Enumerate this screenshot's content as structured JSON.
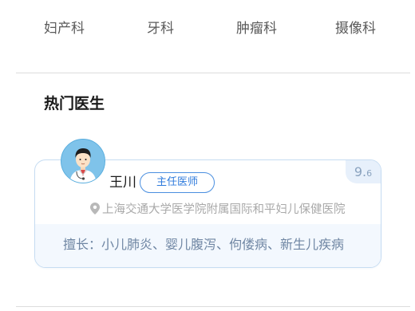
{
  "departments": [
    {
      "label": "妇产科"
    },
    {
      "label": "牙科"
    },
    {
      "label": "肿瘤科"
    },
    {
      "label": "摄像科"
    }
  ],
  "section": {
    "title": "热门医生"
  },
  "doctor": {
    "avatar_icon": "doctor-avatar-icon",
    "name": "王川",
    "title": "主任医师",
    "rating_int": "9.",
    "rating_dec": "6",
    "location_icon": "location-pin-icon",
    "hospital": "上海交通大学医学院附属国际和平妇儿保健医院",
    "specialty": "擅长：小儿肺炎、婴儿腹泻、佝偻病、新生儿疾病"
  },
  "colors": {
    "accent": "#2f7bdc",
    "card_border": "#c6dcf2",
    "card_bottom_bg": "#f3f8fe",
    "avatar_bg": "#7fc3ea"
  }
}
